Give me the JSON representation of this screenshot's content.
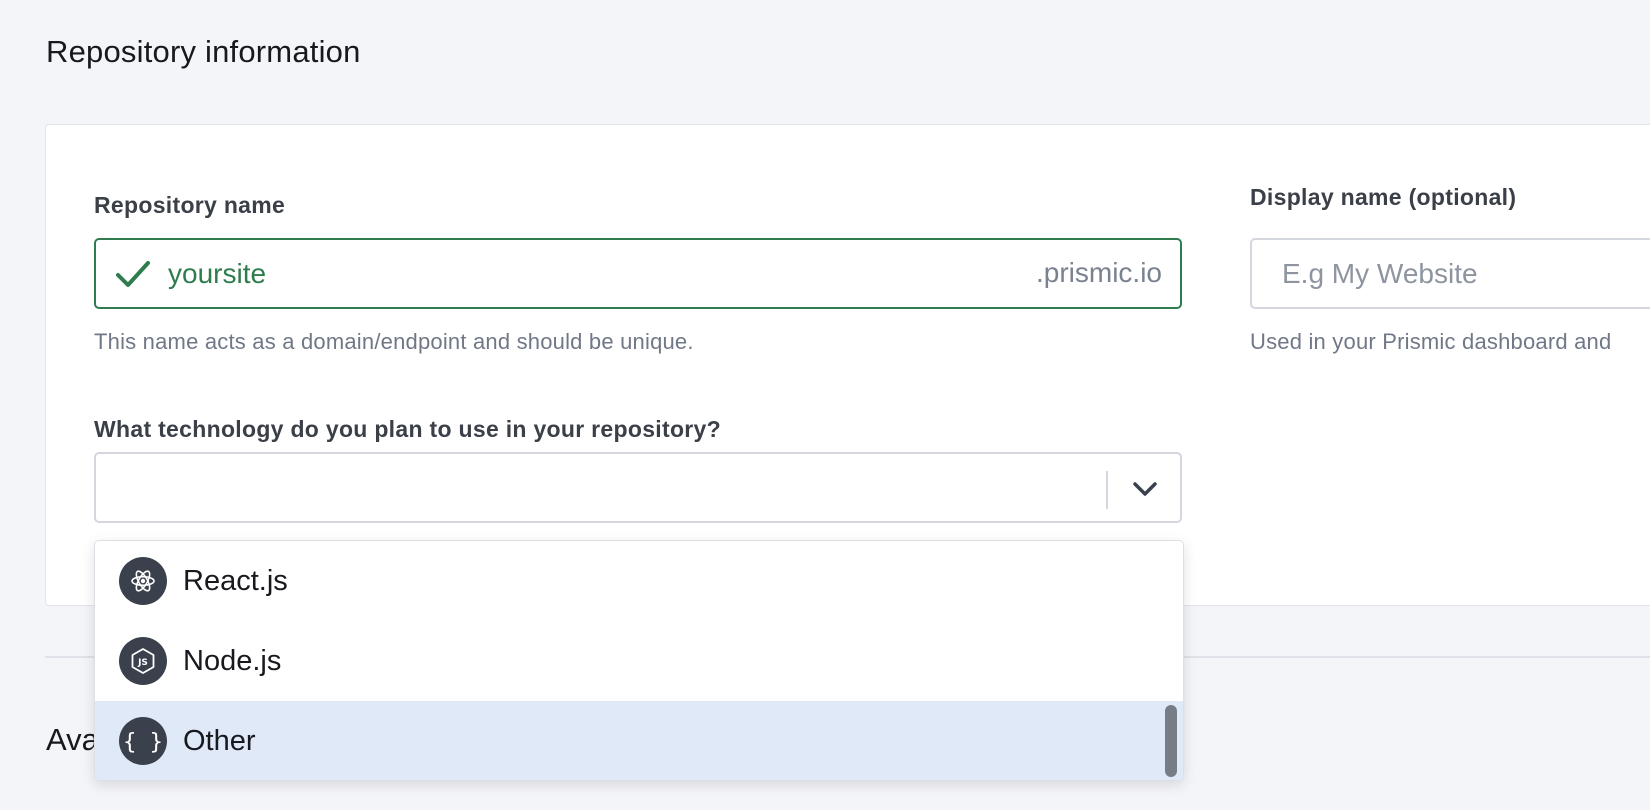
{
  "section": {
    "title": "Repository information"
  },
  "repo": {
    "label": "Repository name",
    "value": "yoursite",
    "suffix": ".prismic.io",
    "hint": "This name acts as a domain/endpoint and should be unique.",
    "status_icon": "check-icon",
    "status_color": "#2f7d4f"
  },
  "display": {
    "label": "Display name (optional)",
    "placeholder": "E.g My Website",
    "hint": "Used in your Prismic dashboard and"
  },
  "technology": {
    "label": "What technology do you plan to use in your repository?",
    "selected_value": "",
    "options": [
      {
        "label": "React.js",
        "icon": "react-icon"
      },
      {
        "label": "Node.js",
        "icon": "nodejs-icon"
      },
      {
        "label": "Other",
        "icon": "braces-icon"
      }
    ],
    "highlighted_option": "Other",
    "highlight_color": "#dfe9f8"
  },
  "next_section": {
    "title_visible": "Ava"
  }
}
